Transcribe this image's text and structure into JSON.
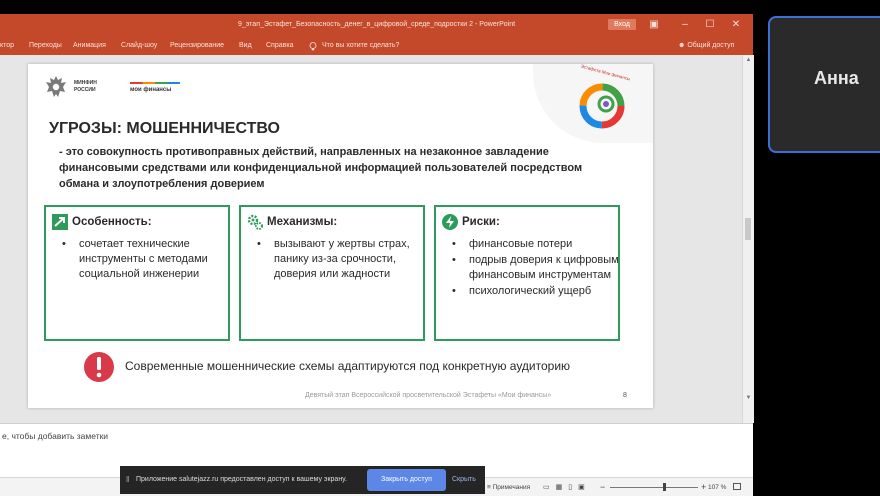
{
  "window": {
    "title": "9_этап_Эстафет_Безопасность_денег_в_цифровой_среде_подростки 2  -  PowerPoint",
    "login_button": "Вход"
  },
  "ribbon": {
    "tabs": [
      "ктор",
      "Переходы",
      "Анимация",
      "Слайд-шоу",
      "Рецензирование",
      "Вид",
      "Справка"
    ],
    "search_placeholder": "Что вы хотите сделать?",
    "share_label": "Общий доступ"
  },
  "slide": {
    "minfin_line1": "МИНФИН",
    "minfin_line2": "РОССИИ",
    "moi_finansy": "мои финансы",
    "estafeta": "Эстафета Мои финансы",
    "heading": "УГРОЗЫ: МОШЕННИЧЕСТВО",
    "description": "- это совокупность противоправных действий, направленных на незаконное завладение финансовыми средствами или конфиденциальной информацией пользователей посредством обмана и злоупотребления доверием",
    "boxes": [
      {
        "title": "Особенность:",
        "icon": "trend-up-icon",
        "items": [
          "сочетает технические инструменты с методами социальной инженерии"
        ]
      },
      {
        "title": "Механизмы:",
        "icon": "gears-icon",
        "items": [
          "вызывают у жертвы страх, панику из-за срочности, доверия или жадности"
        ]
      },
      {
        "title": "Риски:",
        "icon": "lightning-icon",
        "items": [
          "финансовые потери",
          "подрыв доверия к цифровым финансовым инструментам",
          "психологический ущерб"
        ]
      }
    ],
    "alert_text": "Современные мошеннические схемы адаптируются под конкретную аудиторию",
    "footer": "Девятый этап Всероссийской просветительской Эстафеты «Мои финансы»",
    "page_marker": "8"
  },
  "notes": {
    "placeholder": "е, чтобы добавить заметки"
  },
  "status": {
    "notes_label": "Примечания",
    "zoom": "107 %"
  },
  "share_bar": {
    "message": "Приложение salutejazz.ru предоставлен доступ к вашему экрану.",
    "stop_label": "Закрыть доступ",
    "hide_label": "Скрыть"
  },
  "participant": {
    "name": "Анна"
  },
  "colors": {
    "accent": "#c4492a",
    "box_border": "#2e9b5b",
    "alert": "#d93a4a",
    "share_button": "#5c87e6",
    "participant_border": "#3d6fd8"
  }
}
